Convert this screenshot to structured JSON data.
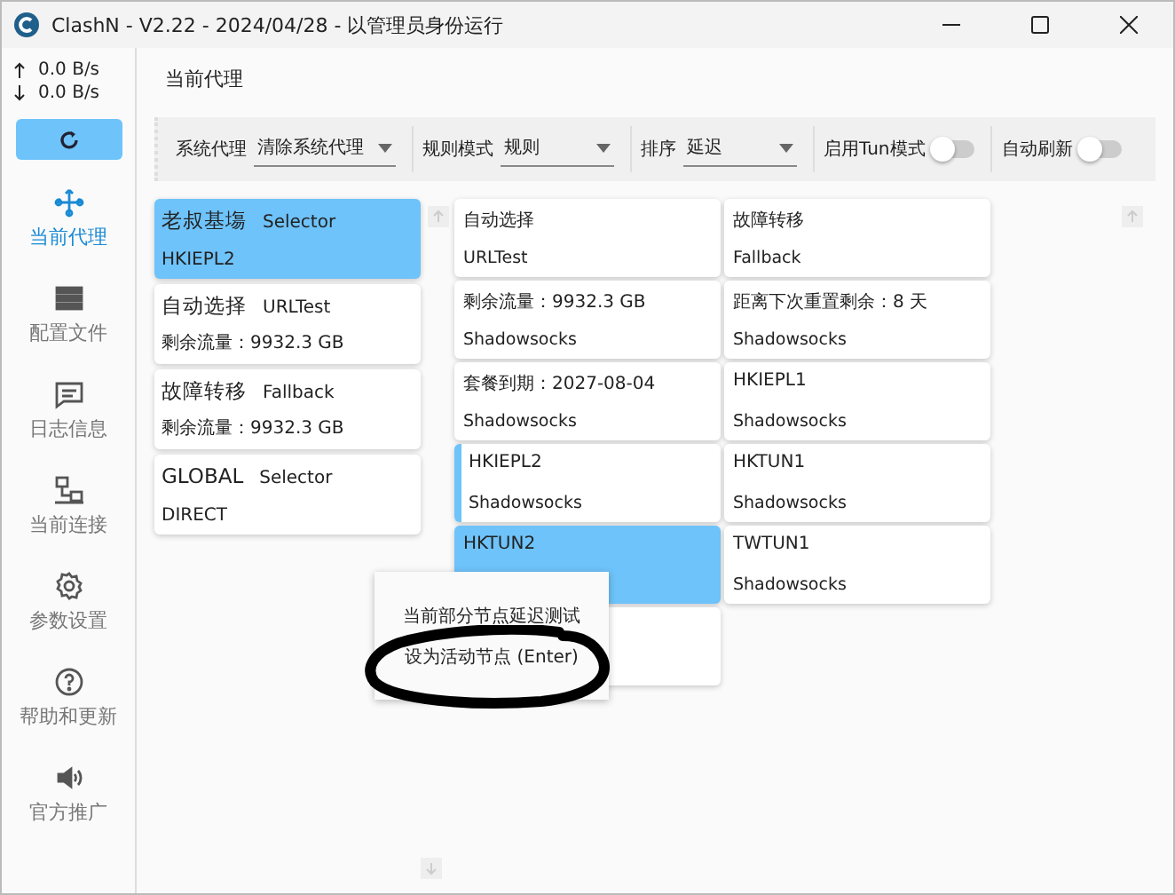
{
  "window": {
    "title": "ClashN - V2.22 - 2024/04/28 - 以管理员身份运行"
  },
  "speed": {
    "up": "0.0 B/s",
    "down": "0.0 B/s"
  },
  "sidebar": {
    "items": [
      {
        "kind": "proxy",
        "label": "当前代理",
        "selected": true
      },
      {
        "kind": "profile",
        "label": "配置文件",
        "selected": false
      },
      {
        "kind": "log",
        "label": "日志信息",
        "selected": false
      },
      {
        "kind": "connection",
        "label": "当前连接",
        "selected": false
      },
      {
        "kind": "settings",
        "label": "参数设置",
        "selected": false
      },
      {
        "kind": "help",
        "label": "帮助和更新",
        "selected": false
      },
      {
        "kind": "promo",
        "label": "官方推广",
        "selected": false
      }
    ]
  },
  "page_title": "当前代理",
  "toolbar": [
    {
      "kind": "select",
      "label": "系统代理",
      "value": "清除系统代理"
    },
    {
      "kind": "select",
      "label": "规则模式",
      "value": "规则"
    },
    {
      "kind": "select",
      "label": "排序",
      "value": "延迟"
    },
    {
      "kind": "toggle",
      "label": "启用Tun模式",
      "on": false
    },
    {
      "kind": "toggle",
      "label": "自动刷新",
      "on": false
    }
  ],
  "groups": [
    {
      "name": "老叔基塲",
      "type": "Selector",
      "now": "HKIEPL2",
      "selected": true
    },
    {
      "name": "自动选择",
      "type": "URLTest",
      "now": "剩余流量：9932.3 GB",
      "selected": false
    },
    {
      "name": "故障转移",
      "type": "Fallback",
      "now": "剩余流量：9932.3 GB",
      "selected": false
    },
    {
      "name": "GLOBAL",
      "type": "Selector",
      "now": "DIRECT",
      "selected": false
    }
  ],
  "proxies": [
    {
      "name": "自动选择",
      "type": "URLTest",
      "selected": false,
      "active": false
    },
    {
      "name": "故障转移",
      "type": "Fallback",
      "selected": false,
      "active": false
    },
    {
      "name": "剩余流量：9932.3 GB",
      "type": "Shadowsocks",
      "selected": false,
      "active": false
    },
    {
      "name": "距离下次重置剩余：8 天",
      "type": "Shadowsocks",
      "selected": false,
      "active": false
    },
    {
      "name": "套餐到期：2027-08-04",
      "type": "Shadowsocks",
      "selected": false,
      "active": false
    },
    {
      "name": "HKIEPL1",
      "type": "Shadowsocks",
      "selected": false,
      "active": false
    },
    {
      "name": "HKIEPL2",
      "type": "Shadowsocks",
      "selected": false,
      "active": true
    },
    {
      "name": "HKTUN1",
      "type": "Shadowsocks",
      "selected": false,
      "active": false
    },
    {
      "name": "HKTUN2",
      "selected": true,
      "active": false
    },
    {
      "name": "TWTUN1",
      "type": "Shadowsocks",
      "selected": false,
      "active": false
    },
    {
      "selected": false
    }
  ],
  "context_menu": [
    "当前部分节点延迟测试",
    "设为活动节点 (Enter)"
  ]
}
